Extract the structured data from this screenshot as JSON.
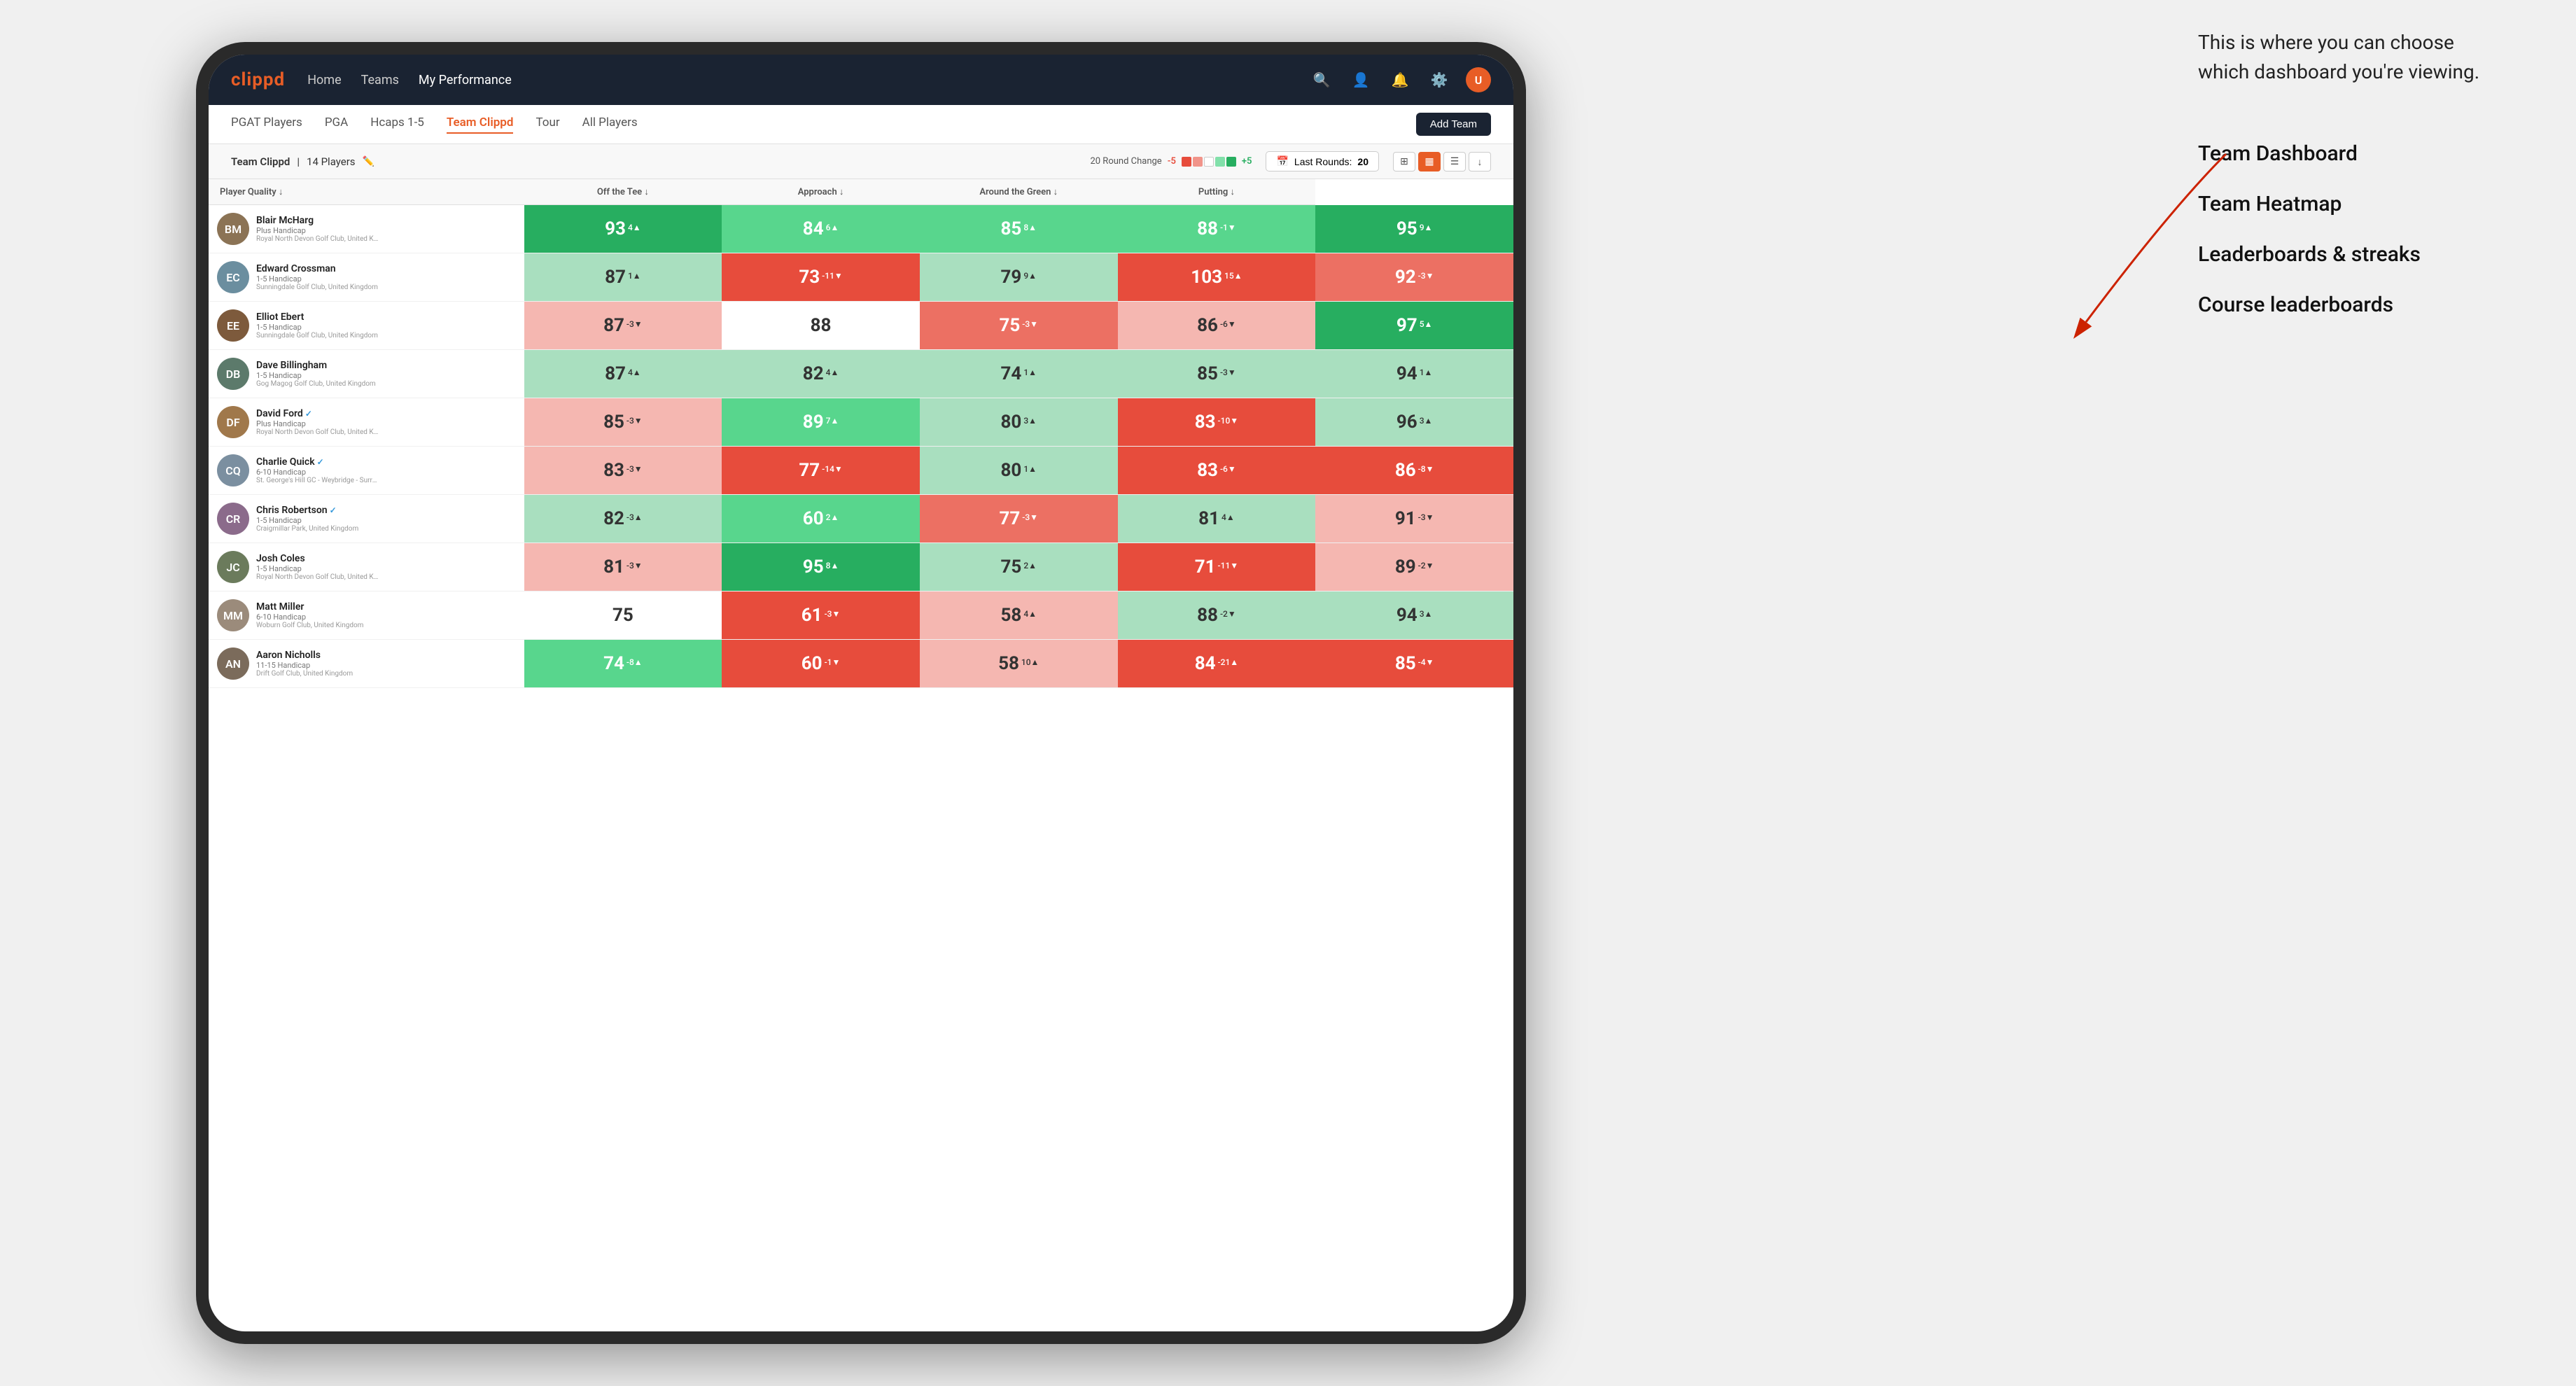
{
  "annotation": {
    "text": "This is where you can choose which dashboard you're viewing.",
    "items": [
      "Team Dashboard",
      "Team Heatmap",
      "Leaderboards & streaks",
      "Course leaderboards"
    ]
  },
  "navbar": {
    "logo": "clippd",
    "links": [
      "Home",
      "Teams",
      "My Performance"
    ],
    "active_link": "My Performance"
  },
  "subnav": {
    "items": [
      "PGAT Players",
      "PGA",
      "Hcaps 1-5",
      "Team Clippd",
      "Tour",
      "All Players"
    ],
    "active_item": "Team Clippd",
    "add_team_label": "Add Team"
  },
  "team_bar": {
    "team_name": "Team Clippd",
    "separator": "|",
    "player_count": "14 Players",
    "round_change_label": "20 Round Change",
    "change_neg": "-5",
    "change_pos": "+5",
    "last_rounds_label": "Last Rounds:",
    "last_rounds_value": "20"
  },
  "table": {
    "columns": [
      "Player Quality ↓",
      "Off the Tee ↓",
      "Approach ↓",
      "Around the Green ↓",
      "Putting ↓"
    ],
    "players": [
      {
        "name": "Blair McHarg",
        "handicap": "Plus Handicap",
        "club": "Royal North Devon Golf Club, United Kingdom",
        "avatar_color": "#8B7355",
        "avatar_initials": "BM",
        "scores": [
          {
            "value": "93",
            "change": "4▲",
            "bg": "bg-dark-green"
          },
          {
            "value": "84",
            "change": "6▲",
            "bg": "bg-med-green"
          },
          {
            "value": "85",
            "change": "8▲",
            "bg": "bg-med-green"
          },
          {
            "value": "88",
            "change": "-1▼",
            "bg": "bg-med-green"
          },
          {
            "value": "95",
            "change": "9▲",
            "bg": "bg-dark-green"
          }
        ]
      },
      {
        "name": "Edward Crossman",
        "handicap": "1-5 Handicap",
        "club": "Sunningdale Golf Club, United Kingdom",
        "avatar_color": "#6B8E9F",
        "avatar_initials": "EC",
        "scores": [
          {
            "value": "87",
            "change": "1▲",
            "bg": "bg-light-green"
          },
          {
            "value": "73",
            "change": "-11▼",
            "bg": "bg-dark-red"
          },
          {
            "value": "79",
            "change": "9▲",
            "bg": "bg-light-green"
          },
          {
            "value": "103",
            "change": "15▲",
            "bg": "bg-dark-red"
          },
          {
            "value": "92",
            "change": "-3▼",
            "bg": "bg-med-red"
          }
        ]
      },
      {
        "name": "Elliot Ebert",
        "handicap": "1-5 Handicap",
        "club": "Sunningdale Golf Club, United Kingdom",
        "avatar_color": "#7D5A3C",
        "avatar_initials": "EE",
        "scores": [
          {
            "value": "87",
            "change": "-3▼",
            "bg": "bg-light-red"
          },
          {
            "value": "88",
            "change": "",
            "bg": "bg-white-cell"
          },
          {
            "value": "75",
            "change": "-3▼",
            "bg": "bg-med-red"
          },
          {
            "value": "86",
            "change": "-6▼",
            "bg": "bg-light-red"
          },
          {
            "value": "97",
            "change": "5▲",
            "bg": "bg-dark-green"
          }
        ]
      },
      {
        "name": "Dave Billingham",
        "handicap": "1-5 Handicap",
        "club": "Gog Magog Golf Club, United Kingdom",
        "avatar_color": "#5C7A6B",
        "avatar_initials": "DB",
        "scores": [
          {
            "value": "87",
            "change": "4▲",
            "bg": "bg-light-green"
          },
          {
            "value": "82",
            "change": "4▲",
            "bg": "bg-light-green"
          },
          {
            "value": "74",
            "change": "1▲",
            "bg": "bg-light-green"
          },
          {
            "value": "85",
            "change": "-3▼",
            "bg": "bg-light-green"
          },
          {
            "value": "94",
            "change": "1▲",
            "bg": "bg-light-green"
          }
        ]
      },
      {
        "name": "David Ford",
        "handicap": "Plus Handicap",
        "club": "Royal North Devon Golf Club, United Kingdom",
        "avatar_color": "#A0784B",
        "avatar_initials": "DF",
        "verified": true,
        "scores": [
          {
            "value": "85",
            "change": "-3▼",
            "bg": "bg-light-red"
          },
          {
            "value": "89",
            "change": "7▲",
            "bg": "bg-med-green"
          },
          {
            "value": "80",
            "change": "3▲",
            "bg": "bg-light-green"
          },
          {
            "value": "83",
            "change": "-10▼",
            "bg": "bg-dark-red"
          },
          {
            "value": "96",
            "change": "3▲",
            "bg": "bg-light-green"
          }
        ]
      },
      {
        "name": "Charlie Quick",
        "handicap": "6-10 Handicap",
        "club": "St. George's Hill GC - Weybridge - Surrey, United Kingdom",
        "avatar_color": "#7B8FA0",
        "avatar_initials": "CQ",
        "verified": true,
        "scores": [
          {
            "value": "83",
            "change": "-3▼",
            "bg": "bg-light-red"
          },
          {
            "value": "77",
            "change": "-14▼",
            "bg": "bg-dark-red"
          },
          {
            "value": "80",
            "change": "1▲",
            "bg": "bg-light-green"
          },
          {
            "value": "83",
            "change": "-6▼",
            "bg": "bg-dark-red"
          },
          {
            "value": "86",
            "change": "-8▼",
            "bg": "bg-dark-red"
          }
        ]
      },
      {
        "name": "Chris Robertson",
        "handicap": "1-5 Handicap",
        "club": "Craigmillar Park, United Kingdom",
        "avatar_color": "#8B6B8B",
        "avatar_initials": "CR",
        "verified": true,
        "scores": [
          {
            "value": "82",
            "change": "-3▲",
            "bg": "bg-light-green"
          },
          {
            "value": "60",
            "change": "2▲",
            "bg": "bg-med-green"
          },
          {
            "value": "77",
            "change": "-3▼",
            "bg": "bg-med-red"
          },
          {
            "value": "81",
            "change": "4▲",
            "bg": "bg-light-green"
          },
          {
            "value": "91",
            "change": "-3▼",
            "bg": "bg-light-red"
          }
        ]
      },
      {
        "name": "Josh Coles",
        "handicap": "1-5 Handicap",
        "club": "Royal North Devon Golf Club, United Kingdom",
        "avatar_color": "#6B7B5C",
        "avatar_initials": "JC",
        "scores": [
          {
            "value": "81",
            "change": "-3▼",
            "bg": "bg-light-red"
          },
          {
            "value": "95",
            "change": "8▲",
            "bg": "bg-dark-green"
          },
          {
            "value": "75",
            "change": "2▲",
            "bg": "bg-light-green"
          },
          {
            "value": "71",
            "change": "-11▼",
            "bg": "bg-dark-red"
          },
          {
            "value": "89",
            "change": "-2▼",
            "bg": "bg-light-red"
          }
        ]
      },
      {
        "name": "Matt Miller",
        "handicap": "6-10 Handicap",
        "club": "Woburn Golf Club, United Kingdom",
        "avatar_color": "#9B8B7B",
        "avatar_initials": "MM",
        "scores": [
          {
            "value": "75",
            "change": "",
            "bg": "bg-white-cell"
          },
          {
            "value": "61",
            "change": "-3▼",
            "bg": "bg-dark-red"
          },
          {
            "value": "58",
            "change": "4▲",
            "bg": "bg-light-red"
          },
          {
            "value": "88",
            "change": "-2▼",
            "bg": "bg-light-green"
          },
          {
            "value": "94",
            "change": "3▲",
            "bg": "bg-light-green"
          }
        ]
      },
      {
        "name": "Aaron Nicholls",
        "handicap": "11-15 Handicap",
        "club": "Drift Golf Club, United Kingdom",
        "avatar_color": "#7B6B5B",
        "avatar_initials": "AN",
        "scores": [
          {
            "value": "74",
            "change": "-8▲",
            "bg": "bg-med-green"
          },
          {
            "value": "60",
            "change": "-1▼",
            "bg": "bg-dark-red"
          },
          {
            "value": "58",
            "change": "10▲",
            "bg": "bg-light-red"
          },
          {
            "value": "84",
            "change": "-21▲",
            "bg": "bg-dark-red"
          },
          {
            "value": "85",
            "change": "-4▼",
            "bg": "bg-dark-red"
          }
        ]
      }
    ]
  }
}
